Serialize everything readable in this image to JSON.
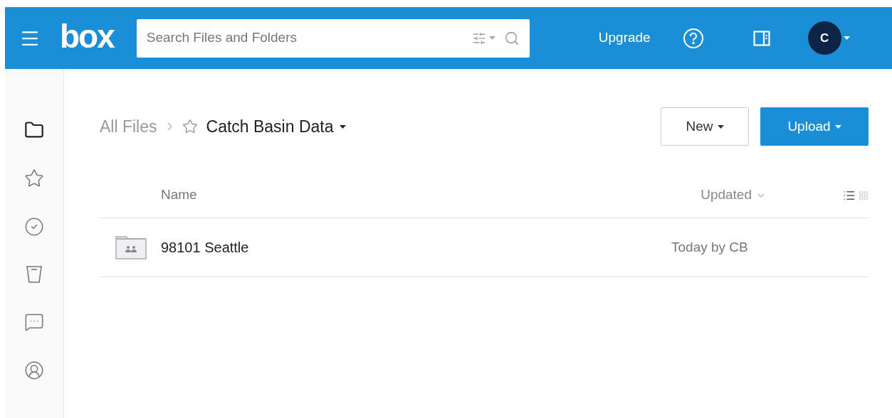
{
  "header": {
    "logo": "box",
    "search": {
      "placeholder": "Search Files and Folders"
    },
    "upgrade": "Upgrade",
    "avatar": "C"
  },
  "sidebar": {
    "items": [
      {
        "kind": "files",
        "selected": true
      },
      {
        "kind": "favorites",
        "selected": false
      },
      {
        "kind": "tasks",
        "selected": false
      },
      {
        "kind": "trash",
        "selected": false
      },
      {
        "kind": "notes",
        "selected": false
      },
      {
        "kind": "account",
        "selected": false
      }
    ]
  },
  "breadcrumb": {
    "root": "All Files",
    "current": "Catch Basin Data",
    "favorite": false
  },
  "buttons": {
    "new": "New",
    "upload": "Upload"
  },
  "table": {
    "columns": [
      "Name",
      "Updated"
    ],
    "views": [
      {
        "kind": "list",
        "selected": true
      },
      {
        "kind": "grid",
        "selected": false
      }
    ],
    "rows": [
      {
        "name": "98101 Seattle",
        "updated": "Today by CB"
      }
    ]
  }
}
